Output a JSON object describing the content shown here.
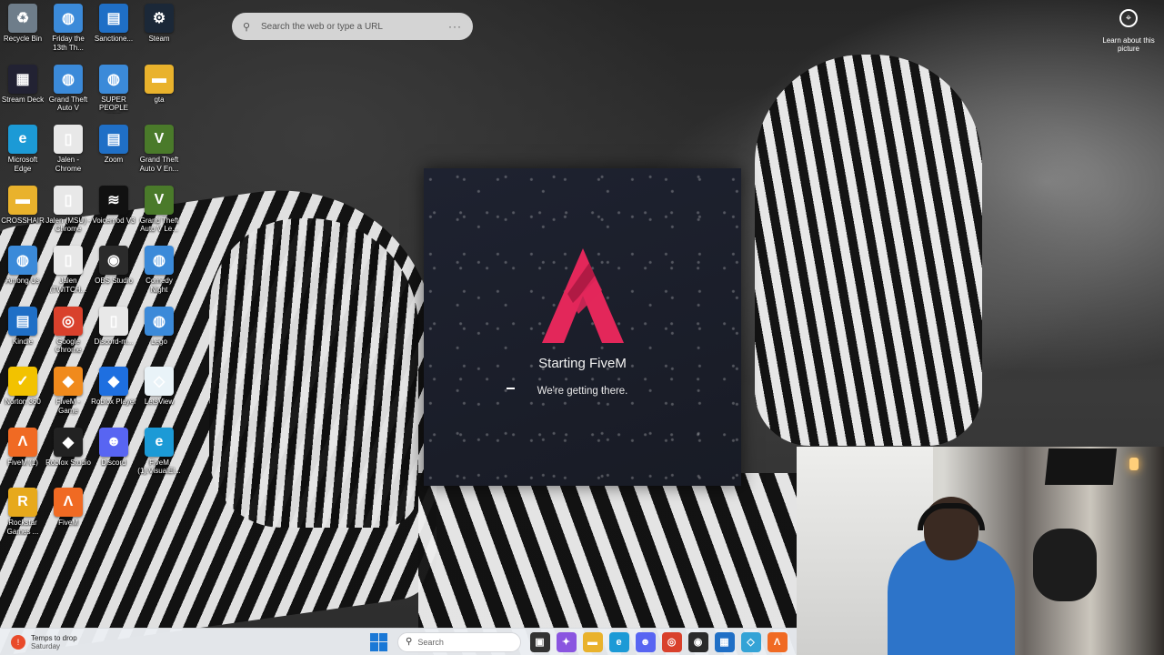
{
  "search_bar": {
    "placeholder": "Search the web or type a URL",
    "more": "···"
  },
  "learn": {
    "label": "Learn about this picture"
  },
  "splash": {
    "title": "Starting FiveM",
    "subtitle": "We're getting there.",
    "accent": "#e3275a"
  },
  "desktop_icons": [
    {
      "name": "recycle-bin-icon",
      "label": "Recycle Bin",
      "glyph": "♻",
      "color": "#6e7d8a"
    },
    {
      "name": "friday-the-13th-icon",
      "label": "Friday the 13th Th...",
      "glyph": "◍",
      "color": "#3b8ad9"
    },
    {
      "name": "sanctioned-icon",
      "label": "Sanctione...",
      "glyph": "▤",
      "color": "#1f6fc6"
    },
    {
      "name": "steam-icon",
      "label": "Steam",
      "glyph": "⚙",
      "color": "#1b2838"
    },
    {
      "name": "stream-deck-icon",
      "label": "Stream Deck",
      "glyph": "▦",
      "color": "#222233"
    },
    {
      "name": "grand-theft-auto-v-icon",
      "label": "Grand Theft Auto V",
      "glyph": "◍",
      "color": "#3b8ad9"
    },
    {
      "name": "super-people-cbt-icon",
      "label": "SUPER PEOPLE CBT",
      "glyph": "◍",
      "color": "#3b8ad9"
    },
    {
      "name": "gta-folder-icon",
      "label": "gta",
      "glyph": "▬",
      "color": "#e9b22c"
    },
    {
      "name": "microsoft-edge-icon",
      "label": "Microsoft Edge",
      "glyph": "e",
      "color": "#1c9ad6"
    },
    {
      "name": "jalen-chrome-icon",
      "label": "Jalen - Chrome",
      "glyph": "▯",
      "color": "#e8e8e8"
    },
    {
      "name": "zoom-icon",
      "label": "Zoom",
      "glyph": "▤",
      "color": "#1f6fc6"
    },
    {
      "name": "grand-theft-auto-v-enhanced-icon",
      "label": "Grand Theft Auto V En...",
      "glyph": "V",
      "color": "#4a7a2a"
    },
    {
      "name": "crosshair-icon",
      "label": "CROSSHAIR",
      "glyph": "▬",
      "color": "#e9b22c"
    },
    {
      "name": "jalen-msu-chrome-icon",
      "label": "Jalen (MSU) - Chrome",
      "glyph": "▯",
      "color": "#e8e8e8"
    },
    {
      "name": "voicemod-icon",
      "label": "Voicemod V3",
      "glyph": "≋",
      "color": "#111"
    },
    {
      "name": "grand-theft-auto-v-legacy-icon",
      "label": "Grand Theft Auto V Le...",
      "glyph": "V",
      "color": "#4a7a2a"
    },
    {
      "name": "among-us-icon",
      "label": "Among Us",
      "glyph": "◍",
      "color": "#3b8ad9"
    },
    {
      "name": "jalen-twitch-icon",
      "label": "Jalen (TWITCH...",
      "glyph": "▯",
      "color": "#e8e8e8"
    },
    {
      "name": "obs-studio-icon",
      "label": "OBS Studio",
      "glyph": "◉",
      "color": "#2b2b2b"
    },
    {
      "name": "comedy-night-icon",
      "label": "Comedy Night",
      "glyph": "◍",
      "color": "#3b8ad9"
    },
    {
      "name": "kindle-icon",
      "label": "Kindle",
      "glyph": "▤",
      "color": "#1f6fc6"
    },
    {
      "name": "google-chrome-icon",
      "label": "Google Chrome",
      "glyph": "◎",
      "color": "#d9412c"
    },
    {
      "name": "discord-m-icon",
      "label": "Discord-m...",
      "glyph": "▯",
      "color": "#e8e8e8"
    },
    {
      "name": "lego-icon",
      "label": "Lego",
      "glyph": "◍",
      "color": "#3b8ad9"
    },
    {
      "name": "norton-360-icon",
      "label": "Norton 360",
      "glyph": "✓",
      "color": "#f2c200"
    },
    {
      "name": "fivem-game-devel-icon",
      "label": "FiveM - Game Devel...",
      "glyph": "◆",
      "color": "#f08a1c"
    },
    {
      "name": "roblox-player-icon",
      "label": "Roblox Player",
      "glyph": "◆",
      "color": "#1e6fe0"
    },
    {
      "name": "letsview-icon",
      "label": "LetsView",
      "glyph": "◇",
      "color": "#e9f3f8"
    },
    {
      "name": "fivem-1-icon",
      "label": "FiveM (1)",
      "glyph": "Λ",
      "color": "#f06a23"
    },
    {
      "name": "roblox-studio-icon",
      "label": "Roblox Studio",
      "glyph": "◆",
      "color": "#222"
    },
    {
      "name": "discord-icon",
      "label": "Discord",
      "glyph": "☻",
      "color": "#5865f2"
    },
    {
      "name": "fivem-visualel-icon",
      "label": "FiveM (1).VisualEl...",
      "glyph": "e",
      "color": "#1c9ad6"
    },
    {
      "name": "rockstar-games-icon",
      "label": "Rockstar Games ...",
      "glyph": "R",
      "color": "#e7a91c"
    },
    {
      "name": "fivem-icon",
      "label": "FiveM",
      "glyph": "Λ",
      "color": "#f06a23"
    }
  ],
  "taskbar": {
    "weather_title": "Temps to drop",
    "weather_sub": "Saturday",
    "search_placeholder": "Search",
    "apps": [
      {
        "name": "task-view-icon",
        "glyph": "▣",
        "color": "#333"
      },
      {
        "name": "copilot-icon",
        "glyph": "✦",
        "color": "#8a55e0"
      },
      {
        "name": "file-explorer-icon",
        "glyph": "▬",
        "color": "#e9b22c"
      },
      {
        "name": "edge-icon",
        "glyph": "e",
        "color": "#1c9ad6"
      },
      {
        "name": "discord-taskbar-icon",
        "glyph": "☻",
        "color": "#5865f2"
      },
      {
        "name": "chrome-taskbar-icon",
        "glyph": "◎",
        "color": "#d9412c"
      },
      {
        "name": "obs-taskbar-icon",
        "glyph": "◉",
        "color": "#2b2b2b"
      },
      {
        "name": "store-icon",
        "glyph": "▦",
        "color": "#1f6fc6"
      },
      {
        "name": "letsview-taskbar-icon",
        "glyph": "◇",
        "color": "#34a3d6"
      },
      {
        "name": "fivem-taskbar-icon",
        "glyph": "Λ",
        "color": "#f06a23"
      }
    ]
  }
}
